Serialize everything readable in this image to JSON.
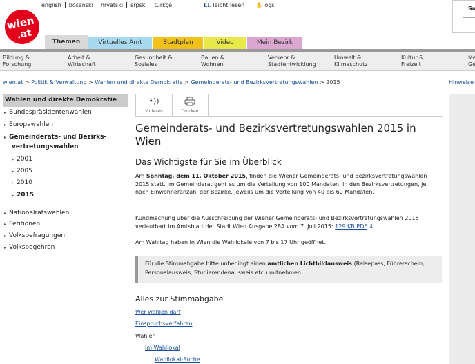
{
  "lang_links": [
    "english",
    "bosanski",
    "hrvatski",
    "srpski",
    "türkçe"
  ],
  "leicht_lesen": {
    "mark": "LL",
    "label": "leicht lesen"
  },
  "ogs_label": "ögs",
  "logo": {
    "line1": "wien",
    "line2": ".at"
  },
  "search": {
    "label": "Su"
  },
  "tabs": [
    {
      "label": "Themen",
      "color": "#d9d9d9"
    },
    {
      "label": "Virtuelles Amt",
      "color": "#a9d9ee"
    },
    {
      "label": "Stadtplan",
      "color": "#f2c21b"
    },
    {
      "label": "Video",
      "color": "#e9e84a"
    },
    {
      "label": "Mein Bezirk",
      "color": "#d9a7cf"
    }
  ],
  "categories": [
    {
      "l1": "Bildung &",
      "l2": "Forschung"
    },
    {
      "l1": "Arbeit &",
      "l2": "Wirtschaft"
    },
    {
      "l1": "Gesundheit &",
      "l2": "Soziales"
    },
    {
      "l1": "Bauen &",
      "l2": "Wohnen"
    },
    {
      "l1": "Verkehr &",
      "l2": "Stadtentwicklung"
    },
    {
      "l1": "Umwelt &",
      "l2": "Klimaschutz"
    },
    {
      "l1": "Kultur &",
      "l2": "Freizeit"
    },
    {
      "l1": "Me",
      "l2": "Ge"
    }
  ],
  "breadcrumb": {
    "c0": "wien.at",
    "c1": "Politik & Verwaltung",
    "c2": "Wahlen und direkte Demokratie",
    "c3": "Gemeinderats- und Bezirksvertretungswahlen",
    "current": "2015",
    "sep": ">"
  },
  "hinweise": "Hinweise z",
  "sidebar": {
    "heading": "Wahlen und direkte Demokratie",
    "items": [
      "Bundespräsidentenwahlen",
      "Europawahlen",
      "Gemeinderats- und Bezirks-",
      "vertretungswahlen",
      "2001",
      "2005",
      "2010",
      "2015",
      "Nationalratswahlen",
      "Petitionen",
      "Volksbefragungen",
      "Volksbegehren"
    ]
  },
  "toolbar": {
    "read": "Vorlesen",
    "print": "Drucken"
  },
  "main": {
    "title": "Gemeinderats- und Bezirksvertretungswahlen 2015 in Wien",
    "subtitle": "Das Wichtigste für Sie im Überblick",
    "p1_a": "Am ",
    "p1_b": "Sonntag, dem 11. Oktober 2015",
    "p1_c": ", finden die Wiener Gemeinderats- und Bezirksvertretungswahlen 2015 statt. Im Gemeinderat geht es um die Verteilung von 100 Mandaten, in den Bezirksvertretungen, je nach Einwohneranzahl der Bezirke, jeweils um die Verteilung von 40 bis 60 Mandaten.",
    "p2_a": "Kundmachung über die Ausschreibung der Wiener Gemeinderats- und Bezirksvertretungswahlen 2015 verlautbart im Amtsblatt der Stadt Wien Ausgabe 28A vom 7. Juli 2015: ",
    "p2_link": "129 KB PDF",
    "p3": "Am Wahltag haben in Wien die Wahllokale von 7 bis 17 Uhr geöffnet.",
    "note_a": "Für die Stimmabgabe bitte unbedingt einen ",
    "note_b": "amtlichen Lichtbildausweis",
    "note_c": " (Reisepass, Führerschein, Personalausweis, Studierendenausweis etc.) mitnehmen.",
    "section": "Alles zur Stimmabgabe",
    "links": {
      "wer": "Wer wählen darf",
      "einspruch": "Einspruchsverfahren",
      "waehlen": "Wählen",
      "wahllokal": "im Wahllokal",
      "suche": "Wahllokal-Suche"
    }
  }
}
